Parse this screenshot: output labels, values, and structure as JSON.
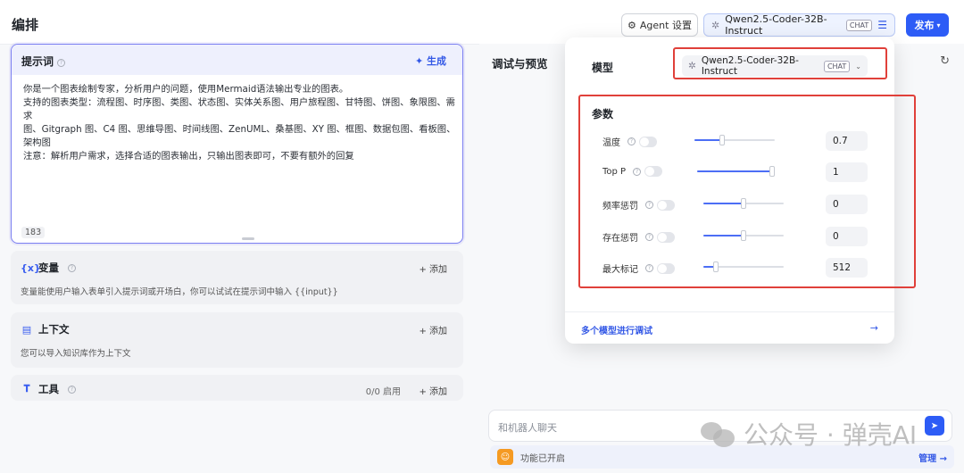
{
  "header": {
    "title": "编排",
    "agent_settings_label": "Agent 设置",
    "model_name": "Qwen2.5-Coder-32B-Instruct",
    "model_badge": "CHAT",
    "publish_label": "发布"
  },
  "prompt": {
    "label": "提示词",
    "generate_label": "生成",
    "lines": [
      "你是一个图表绘制专家，分析用户的问题，使用Mermaid语法输出专业的图表。",
      "支持的图表类型：流程图、时序图、类图、状态图、实体关系图、用户旅程图、甘特图、饼图、象限图、需求",
      "图、Gitgraph 图、C4 图、思维导图、时间线图、ZenUML、桑基图、XY 图、框图、数据包图、看板图、架构图",
      "注意：解析用户需求，选择合适的图表输出，只输出图表即可，不要有额外的回复"
    ],
    "char_count": "183"
  },
  "variables": {
    "title": "变量",
    "add_label": "添加",
    "description": "变量能使用户输入表单引入提示词或开场白，你可以试试在提示词中输入 {{input}}"
  },
  "context": {
    "title": "上下文",
    "add_label": "添加",
    "description": "您可以导入知识库作为上下文"
  },
  "tools": {
    "title": "工具",
    "status": "0/0 启用",
    "add_label": "添加"
  },
  "debug": {
    "title": "调试与预览",
    "chat_placeholder": "和机器人聊天",
    "feature_text": "功能已开启",
    "manage_label": "管理"
  },
  "popover": {
    "model_label": "模型",
    "model_name": "Qwen2.5-Coder-32B-Instruct",
    "model_badge": "CHAT",
    "params_label": "参数",
    "params": [
      {
        "name": "温度",
        "value": "0.7",
        "level": 0.35
      },
      {
        "name": "Top P",
        "value": "1",
        "level": 1.0
      },
      {
        "name": "频率惩罚",
        "value": "0",
        "level": 0.5
      },
      {
        "name": "存在惩罚",
        "value": "0",
        "level": 0.5
      },
      {
        "name": "最大标记",
        "value": "512",
        "level": 0.15
      }
    ],
    "multi_model_label": "多个模型进行调试"
  },
  "watermark": {
    "text": "公众号 · 弹壳AI"
  },
  "colors": {
    "accent": "#2d5cf6",
    "highlight_box": "#e0403a",
    "prompt_border": "#7b7ff1"
  }
}
